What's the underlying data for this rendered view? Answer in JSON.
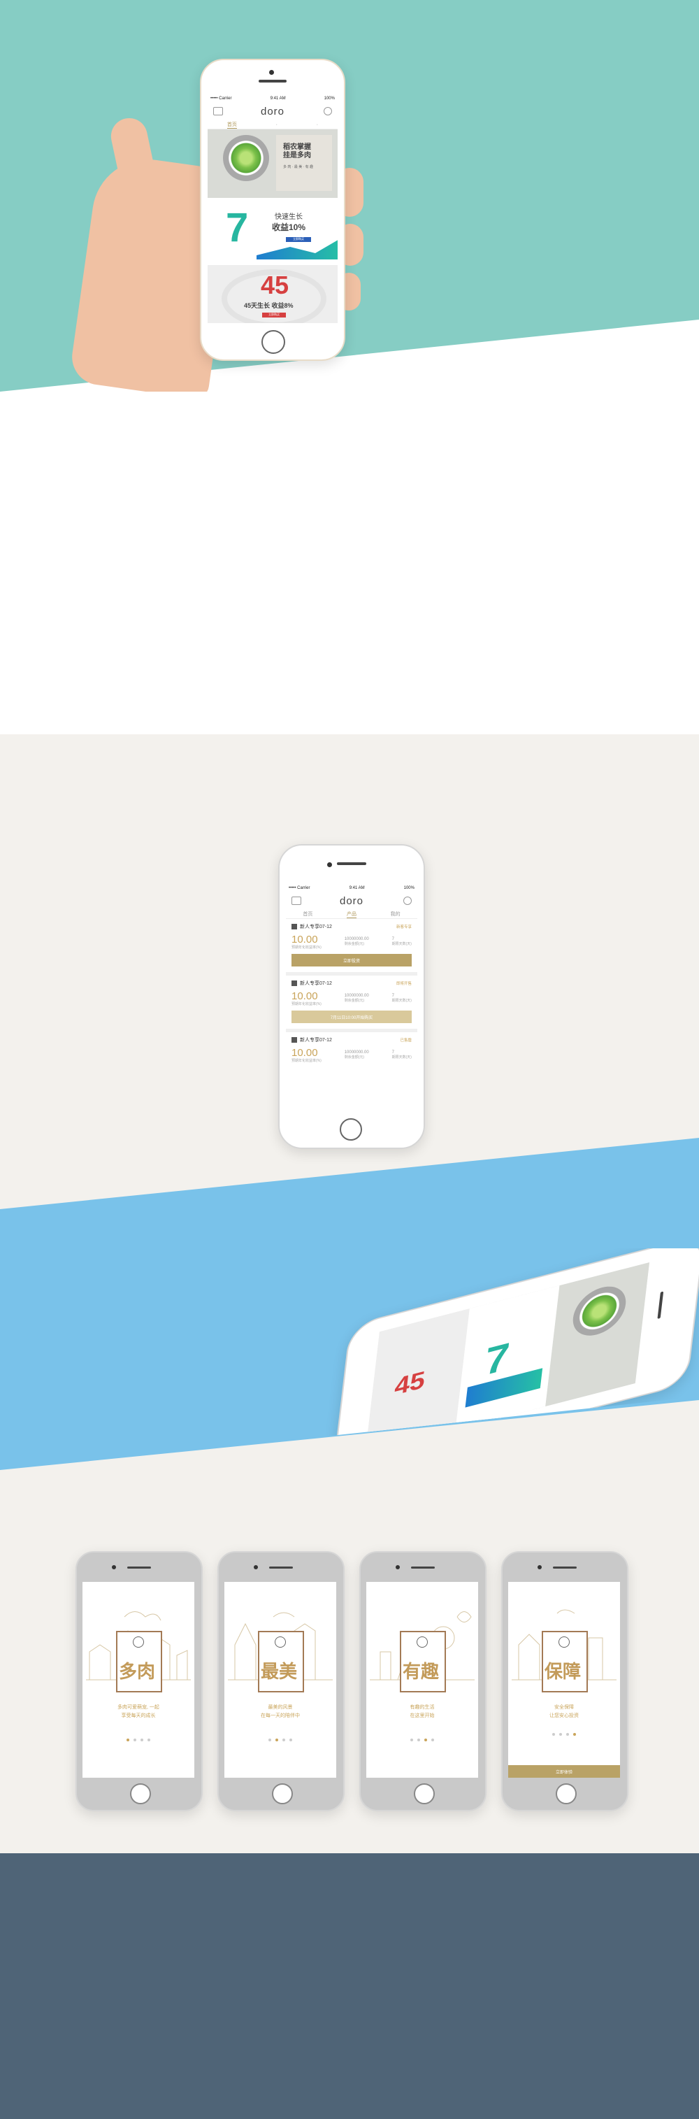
{
  "colors": {
    "teal_bg": "#86cdc4",
    "light_bg": "#f3f1ed",
    "blue_bg": "#79c2ea",
    "footer_bg": "#4f6477",
    "gold": "#b9a266",
    "red": "#d64040"
  },
  "app": {
    "logo": "doro"
  },
  "phone_home": {
    "status_left": "••••• Carrier",
    "status_time": "9:41 AM",
    "status_right": "100%",
    "tabs": [
      "首页",
      "",
      ""
    ],
    "banner1": {
      "title_line1": "稻农掌握",
      "title_line2": "挂是多肉",
      "subtitle": "多 肉 · 最 美 · 有 趣"
    },
    "banner2": {
      "number": "7",
      "line1": "快速生长",
      "line2": "收益10%",
      "button": "立即购买"
    },
    "banner3": {
      "number": "45",
      "line1": "45天生长  收益8%",
      "button": "立即购买"
    }
  },
  "phone_products": {
    "status_left": "••••• Carrier",
    "status_time": "9:41 AM",
    "status_right": "100%",
    "tabs": [
      "首页",
      "产品",
      "我的"
    ],
    "items": [
      {
        "title": "新人专享07-12",
        "tag": "新客专享",
        "rate": "10.00",
        "rate_label": "预期年化收益率(%)",
        "amount": "10000000.00",
        "amount_label": "剩余金额(元)",
        "days": "7",
        "days_label": "期限天数(天)",
        "button": "立即投资"
      },
      {
        "title": "新人专享07-12",
        "tag": "即将开售",
        "rate": "10.00",
        "rate_label": "预期年化收益率(%)",
        "amount": "10000000.00",
        "amount_label": "剩余金额(元)",
        "days": "7",
        "days_label": "期限天数(天)",
        "button": "7月11日10:00开始购买"
      },
      {
        "title": "新人专享07-12",
        "tag": "已售罄",
        "rate": "10.00",
        "rate_label": "预期年化收益率(%)",
        "amount": "10000000.00",
        "amount_label": "剩余金额(元)",
        "days": "7",
        "days_label": "期限天数(天)"
      }
    ]
  },
  "onboarding": [
    {
      "word": "多肉",
      "desc_line1": "多肉可爱萌宠, 一起",
      "desc_line2": "享受每天的成长",
      "active_dot": 0
    },
    {
      "word": "最美",
      "desc_line1": "最美的风景",
      "desc_line2": "在每一天的陪伴中",
      "active_dot": 1
    },
    {
      "word": "有趣",
      "desc_line1": "有趣的生活",
      "desc_line2": "在这里开始",
      "active_dot": 2
    },
    {
      "word": "保障",
      "desc_line1": "安全保障",
      "desc_line2": "让您安心投资",
      "active_dot": 3,
      "button": "立即体验"
    }
  ]
}
